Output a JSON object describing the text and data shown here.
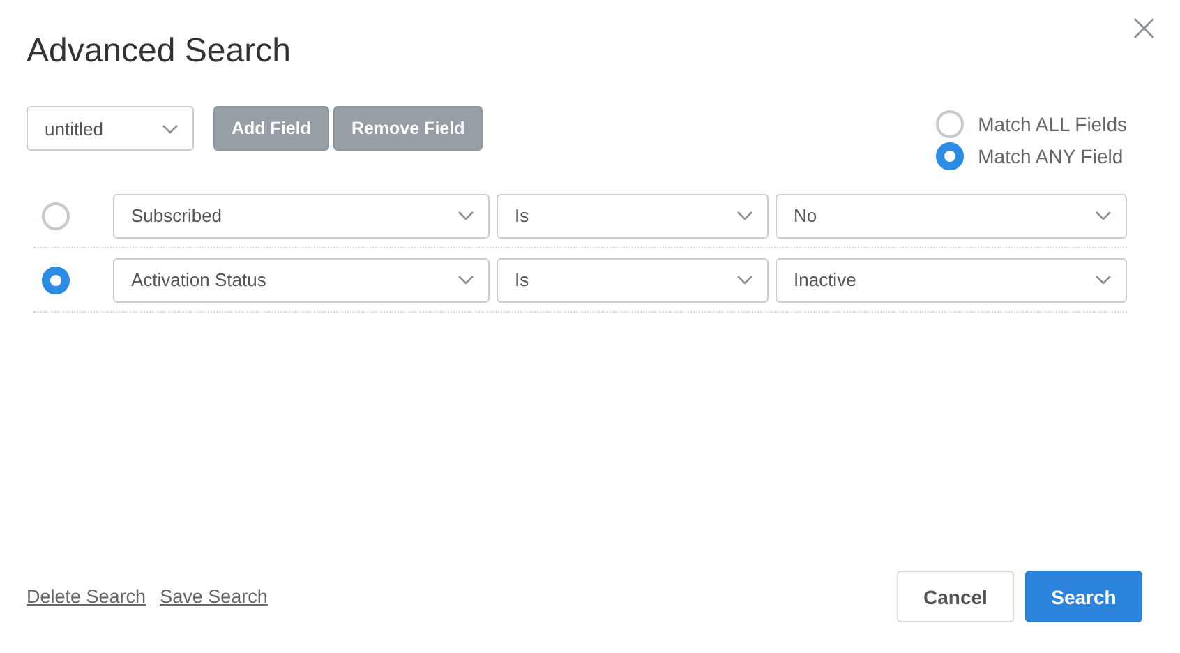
{
  "dialog": {
    "title": "Advanced Search",
    "close": "×"
  },
  "toolbar": {
    "saved_search": {
      "value": "untitled"
    },
    "buttons": [
      "Add Field",
      "Remove Field"
    ]
  },
  "match_options": [
    {
      "label": "Match ALL Fields",
      "selected": false
    },
    {
      "label": "Match ANY Field",
      "selected": true
    }
  ],
  "criteria": [
    {
      "selected": false,
      "field": "Subscribed",
      "operator": "Is",
      "value": "No"
    },
    {
      "selected": true,
      "field": "Activation Status",
      "operator": "Is",
      "value": "Inactive"
    }
  ],
  "footer": {
    "links": [
      "Delete Search",
      "Save Search"
    ],
    "cancel": "Cancel",
    "submit": "Search"
  }
}
